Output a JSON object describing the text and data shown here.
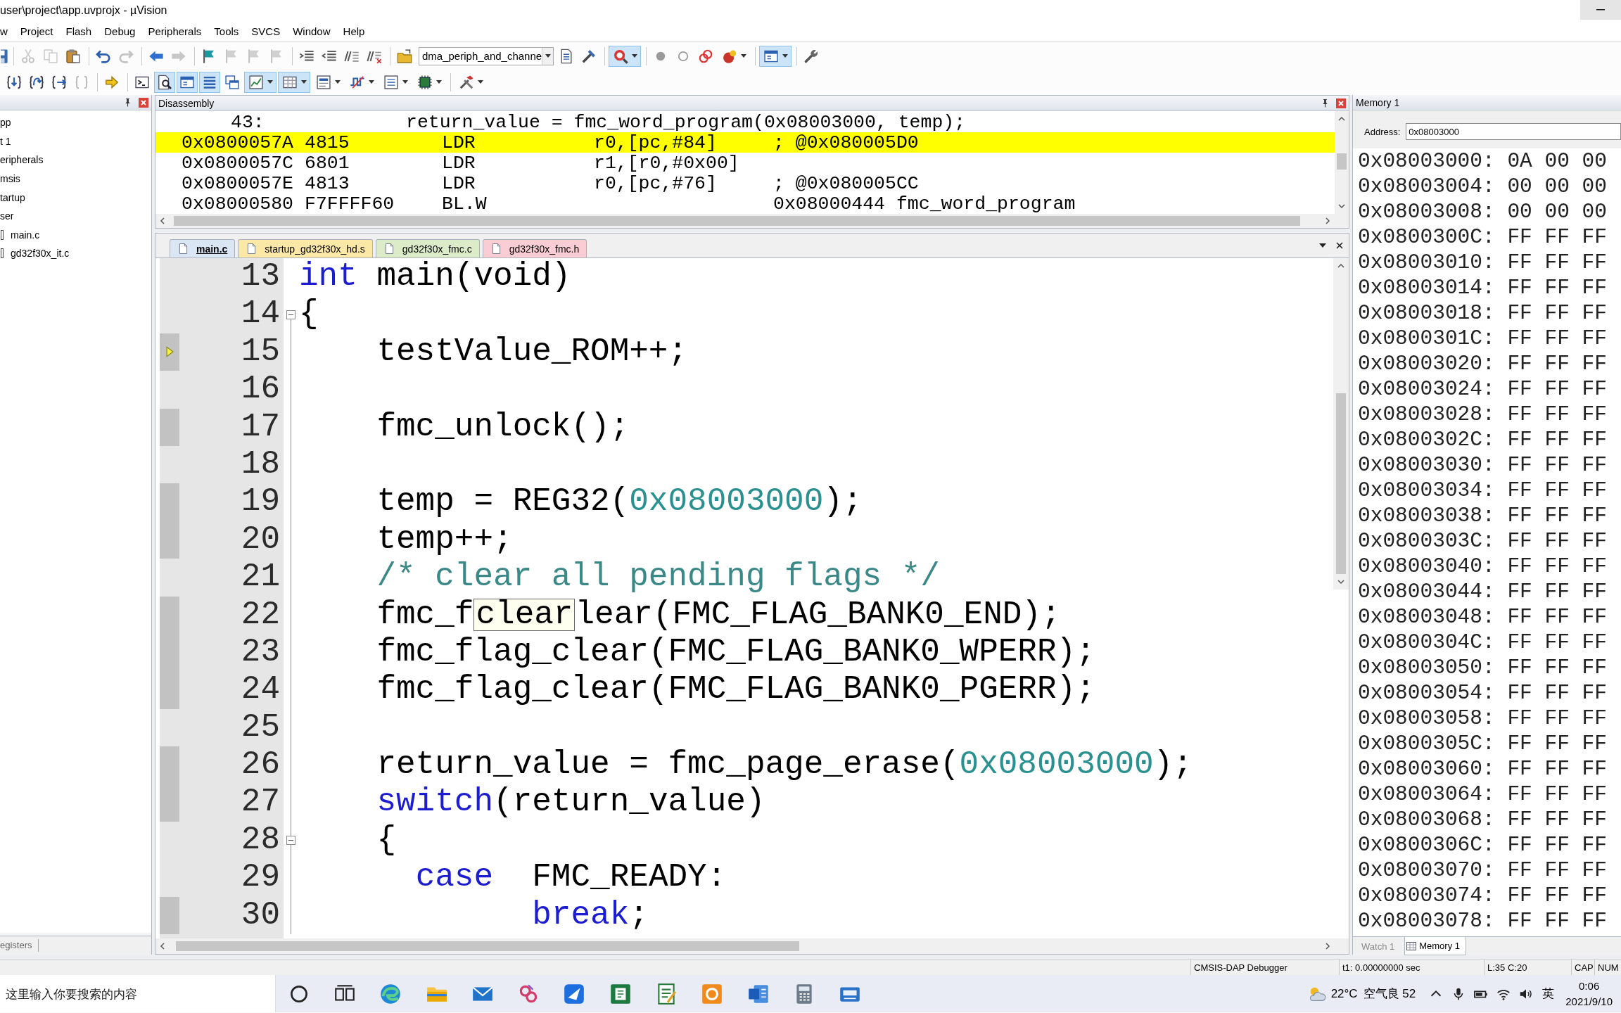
{
  "window": {
    "title": "user\\project\\app.uvprojx - µVision"
  },
  "menu": [
    "w",
    "Project",
    "Flash",
    "Debug",
    "Peripherals",
    "Tools",
    "SVCS",
    "Window",
    "Help"
  ],
  "toolbar_1": [
    [
      {
        "kind": "button",
        "disabled": false,
        "pressed": false,
        "dropdown": false
      }
    ],
    [
      {
        "kind": "button",
        "disabled": true,
        "pressed": false,
        "dropdown": false
      },
      {
        "kind": "button",
        "disabled": true,
        "pressed": false,
        "dropdown": false
      },
      {
        "kind": "button",
        "disabled": false,
        "pressed": false,
        "dropdown": false
      }
    ],
    [
      {
        "kind": "button",
        "disabled": false,
        "pressed": false,
        "dropdown": false
      },
      {
        "kind": "button",
        "disabled": true,
        "pressed": false,
        "dropdown": false
      }
    ],
    [
      {
        "kind": "button",
        "disabled": false,
        "pressed": false,
        "dropdown": false
      },
      {
        "kind": "button",
        "disabled": true,
        "pressed": false,
        "dropdown": false
      }
    ],
    [
      {
        "kind": "button",
        "disabled": false,
        "pressed": false,
        "dropdown": false
      },
      {
        "kind": "button",
        "disabled": true,
        "pressed": false,
        "dropdown": false
      },
      {
        "kind": "button",
        "disabled": true,
        "pressed": false,
        "dropdown": false
      },
      {
        "kind": "button",
        "disabled": true,
        "pressed": false,
        "dropdown": false
      }
    ],
    [
      {
        "kind": "button",
        "disabled": false,
        "pressed": false,
        "dropdown": false
      },
      {
        "kind": "button",
        "disabled": false,
        "pressed": false,
        "dropdown": false
      },
      {
        "kind": "button",
        "disabled": false,
        "pressed": false,
        "dropdown": false
      },
      {
        "kind": "button",
        "disabled": false,
        "pressed": false,
        "dropdown": false
      }
    ],
    [
      {
        "kind": "button",
        "disabled": false,
        "pressed": false,
        "dropdown": false
      },
      {
        "kind": "combo",
        "value": "dma_periph_and_channe"
      },
      {
        "kind": "button",
        "disabled": false,
        "pressed": false,
        "dropdown": false
      },
      {
        "kind": "button",
        "disabled": false,
        "pressed": false,
        "dropdown": false
      }
    ],
    [
      {
        "kind": "button",
        "disabled": false,
        "pressed": true,
        "dropdown": true
      }
    ],
    [
      {
        "kind": "button",
        "disabled": false,
        "pressed": false,
        "dropdown": false
      },
      {
        "kind": "button",
        "disabled": false,
        "pressed": false,
        "dropdown": false
      },
      {
        "kind": "button",
        "disabled": false,
        "pressed": false,
        "dropdown": false
      },
      {
        "kind": "button",
        "disabled": false,
        "pressed": false,
        "dropdown": true
      }
    ],
    [
      {
        "kind": "button",
        "disabled": false,
        "pressed": true,
        "dropdown": true
      }
    ],
    [
      {
        "kind": "button",
        "disabled": false,
        "pressed": false,
        "dropdown": false
      }
    ]
  ],
  "toolbar_2": [
    [
      {
        "kind": "button",
        "disabled": false,
        "pressed": false,
        "dropdown": false
      },
      {
        "kind": "button",
        "disabled": false,
        "pressed": false,
        "dropdown": false
      },
      {
        "kind": "button",
        "disabled": false,
        "pressed": false,
        "dropdown": false
      },
      {
        "kind": "button",
        "disabled": true,
        "pressed": false,
        "dropdown": false
      }
    ],
    [
      {
        "kind": "button",
        "disabled": false,
        "pressed": false,
        "dropdown": false
      }
    ],
    [
      {
        "kind": "button",
        "disabled": false,
        "pressed": false,
        "dropdown": false
      },
      {
        "kind": "button",
        "disabled": false,
        "pressed": true,
        "dropdown": false
      },
      {
        "kind": "button",
        "disabled": false,
        "pressed": true,
        "dropdown": false
      },
      {
        "kind": "button",
        "disabled": false,
        "pressed": true,
        "dropdown": false
      },
      {
        "kind": "button",
        "disabled": false,
        "pressed": false,
        "dropdown": false
      },
      {
        "kind": "button",
        "disabled": false,
        "pressed": true,
        "dropdown": true
      },
      {
        "kind": "button",
        "disabled": false,
        "pressed": true,
        "dropdown": true
      },
      {
        "kind": "button",
        "disabled": false,
        "pressed": false,
        "dropdown": true
      },
      {
        "kind": "button",
        "disabled": false,
        "pressed": false,
        "dropdown": true
      },
      {
        "kind": "button",
        "disabled": false,
        "pressed": false,
        "dropdown": true
      },
      {
        "kind": "button",
        "disabled": false,
        "pressed": false,
        "dropdown": true
      }
    ],
    [
      {
        "kind": "button",
        "disabled": false,
        "pressed": false,
        "dropdown": true
      }
    ]
  ],
  "project_panel": {
    "items": [
      {
        "label": "pp",
        "kind": "group",
        "children": [
          {
            "label": "t 1",
            "kind": "group",
            "children": [
              {
                "label": "eripherals",
                "kind": "group"
              },
              {
                "label": "msis",
                "kind": "group"
              },
              {
                "label": "tartup",
                "kind": "group"
              },
              {
                "label": "ser",
                "kind": "group",
                "children": [
                  {
                    "label": "main.c",
                    "kind": "file"
                  },
                  {
                    "label": "gd32f30x_it.c",
                    "kind": "file"
                  }
                ]
              }
            ]
          }
        ]
      }
    ],
    "tabs": [
      {
        "label": "egisters"
      }
    ]
  },
  "disassembly": {
    "title": "Disassembly",
    "lines": [
      {
        "kind": "source",
        "number": "43:",
        "text": "return_value = fmc_word_program(0x08003000, temp);",
        "selected": false
      },
      {
        "kind": "instruction",
        "address": "0x0800057A",
        "opcode": "4815",
        "mnemonic": "LDR",
        "operands": "r0,[pc,#84]",
        "comment": "; @0x080005D0",
        "selected": true
      },
      {
        "kind": "instruction",
        "address": "0x0800057C",
        "opcode": "6801",
        "mnemonic": "LDR",
        "operands": "r1,[r0,#0x00]",
        "selected": false
      },
      {
        "kind": "instruction",
        "address": "0x0800057E",
        "opcode": "4813",
        "mnemonic": "LDR",
        "operands": "r0,[pc,#76]",
        "comment": "; @0x080005CC",
        "selected": false
      },
      {
        "kind": "instruction",
        "address": "0x08000580",
        "opcode": "F7FFFF60",
        "mnemonic": "BL.W",
        "target": "0x08000444 fmc_word_program",
        "selected": false
      }
    ]
  },
  "editor": {
    "tabs": [
      {
        "label": "main.c",
        "selected": true,
        "color": "#dbe6f5"
      },
      {
        "label": "startup_gd32f30x_hd.s",
        "selected": false,
        "color": "#fbe8a6"
      },
      {
        "label": "gd32f30x_fmc.c",
        "selected": false,
        "color": "#dcecc9"
      },
      {
        "label": "gd32f30x_fmc.h",
        "selected": false,
        "color": "#f9cdd3"
      }
    ],
    "lines": [
      {
        "number": "13",
        "executable": false,
        "current": false,
        "fold": false,
        "segments": [
          {
            "kind": "keyword",
            "text": "int"
          },
          {
            "kind": "text",
            "text": " main(void)"
          }
        ]
      },
      {
        "number": "14",
        "executable": false,
        "current": false,
        "fold": true,
        "segments": [
          {
            "kind": "text",
            "text": "{"
          }
        ]
      },
      {
        "number": "15",
        "executable": true,
        "current": true,
        "fold": false,
        "segments": [
          {
            "kind": "text",
            "text": "    testValue_ROM++;"
          }
        ]
      },
      {
        "number": "16",
        "executable": false,
        "current": false,
        "fold": false
      },
      {
        "number": "17",
        "executable": true,
        "current": false,
        "fold": false,
        "segments": [
          {
            "kind": "text",
            "text": "    fmc_unlock();"
          }
        ]
      },
      {
        "number": "18",
        "executable": false,
        "current": false,
        "fold": false
      },
      {
        "number": "19",
        "executable": true,
        "current": false,
        "fold": false,
        "segments": [
          {
            "kind": "text",
            "text": "    temp = REG32("
          },
          {
            "kind": "number",
            "text": "0x08003000"
          },
          {
            "kind": "text",
            "text": ");"
          }
        ]
      },
      {
        "number": "20",
        "executable": true,
        "current": false,
        "fold": false,
        "segments": [
          {
            "kind": "text",
            "text": "    temp++;"
          }
        ]
      },
      {
        "number": "21",
        "executable": false,
        "current": false,
        "fold": false,
        "segments": [
          {
            "kind": "comment",
            "text": "    /* clear all pending flags */"
          }
        ]
      },
      {
        "number": "22",
        "executable": true,
        "current": false,
        "fold": false,
        "segments": [
          {
            "kind": "text",
            "text": "    fmc_f"
          },
          {
            "kind": "tooltip",
            "text": "clear"
          },
          {
            "kind": "text",
            "text": "lear(FMC_FLAG_BANK0_END);"
          }
        ]
      },
      {
        "number": "23",
        "executable": true,
        "current": false,
        "fold": false,
        "segments": [
          {
            "kind": "text",
            "text": "    fmc_flag_clear(FMC_FLAG_BANK0_WPERR);"
          }
        ]
      },
      {
        "number": "24",
        "executable": true,
        "current": false,
        "fold": false,
        "segments": [
          {
            "kind": "text",
            "text": "    fmc_flag_clear(FMC_FLAG_BANK0_PGERR);"
          }
        ]
      },
      {
        "number": "25",
        "executable": false,
        "current": false,
        "fold": false
      },
      {
        "number": "26",
        "executable": true,
        "current": false,
        "fold": false,
        "segments": [
          {
            "kind": "text",
            "text": "    return_value = fmc_page_erase("
          },
          {
            "kind": "number",
            "text": "0x08003000"
          },
          {
            "kind": "text",
            "text": ");"
          }
        ]
      },
      {
        "number": "27",
        "executable": true,
        "current": false,
        "fold": false,
        "segments": [
          {
            "kind": "keyword",
            "text": "    switch"
          },
          {
            "kind": "text",
            "text": "(return_value)"
          }
        ]
      },
      {
        "number": "28",
        "executable": false,
        "current": false,
        "fold": true,
        "segments": [
          {
            "kind": "text",
            "text": "    {"
          }
        ]
      },
      {
        "number": "29",
        "executable": false,
        "current": false,
        "fold": false,
        "segments": [
          {
            "kind": "keyword",
            "text": "      case"
          },
          {
            "kind": "text",
            "text": "  FMC_READY:"
          }
        ]
      },
      {
        "number": "30",
        "executable": true,
        "current": false,
        "fold": false,
        "segments": [
          {
            "kind": "keyword",
            "text": "            break"
          },
          {
            "kind": "text",
            "text": ";"
          }
        ]
      }
    ]
  },
  "memory": {
    "title": "Memory 1",
    "address_field": {
      "label": "Address:",
      "value": "0x08003000"
    },
    "rows": [
      {
        "address": "0x08003000:",
        "bytes": [
          "0A",
          "00",
          "00"
        ]
      },
      {
        "address": "0x08003004:",
        "bytes": [
          "00",
          "00",
          "00"
        ]
      },
      {
        "address": "0x08003008:",
        "bytes": [
          "00",
          "00",
          "00"
        ]
      },
      {
        "address": "0x0800300C:",
        "bytes": [
          "FF",
          "FF",
          "FF"
        ]
      },
      {
        "address": "0x08003010:",
        "bytes": [
          "FF",
          "FF",
          "FF"
        ]
      },
      {
        "address": "0x08003014:",
        "bytes": [
          "FF",
          "FF",
          "FF"
        ]
      },
      {
        "address": "0x08003018:",
        "bytes": [
          "FF",
          "FF",
          "FF"
        ]
      },
      {
        "address": "0x0800301C:",
        "bytes": [
          "FF",
          "FF",
          "FF"
        ]
      },
      {
        "address": "0x08003020:",
        "bytes": [
          "FF",
          "FF",
          "FF"
        ]
      },
      {
        "address": "0x08003024:",
        "bytes": [
          "FF",
          "FF",
          "FF"
        ]
      },
      {
        "address": "0x08003028:",
        "bytes": [
          "FF",
          "FF",
          "FF"
        ]
      },
      {
        "address": "0x0800302C:",
        "bytes": [
          "FF",
          "FF",
          "FF"
        ]
      },
      {
        "address": "0x08003030:",
        "bytes": [
          "FF",
          "FF",
          "FF"
        ]
      },
      {
        "address": "0x08003034:",
        "bytes": [
          "FF",
          "FF",
          "FF"
        ]
      },
      {
        "address": "0x08003038:",
        "bytes": [
          "FF",
          "FF",
          "FF"
        ]
      },
      {
        "address": "0x0800303C:",
        "bytes": [
          "FF",
          "FF",
          "FF"
        ]
      },
      {
        "address": "0x08003040:",
        "bytes": [
          "FF",
          "FF",
          "FF"
        ]
      },
      {
        "address": "0x08003044:",
        "bytes": [
          "FF",
          "FF",
          "FF"
        ]
      },
      {
        "address": "0x08003048:",
        "bytes": [
          "FF",
          "FF",
          "FF"
        ]
      },
      {
        "address": "0x0800304C:",
        "bytes": [
          "FF",
          "FF",
          "FF"
        ]
      },
      {
        "address": "0x08003050:",
        "bytes": [
          "FF",
          "FF",
          "FF"
        ]
      },
      {
        "address": "0x08003054:",
        "bytes": [
          "FF",
          "FF",
          "FF"
        ]
      },
      {
        "address": "0x08003058:",
        "bytes": [
          "FF",
          "FF",
          "FF"
        ]
      },
      {
        "address": "0x0800305C:",
        "bytes": [
          "FF",
          "FF",
          "FF"
        ]
      },
      {
        "address": "0x08003060:",
        "bytes": [
          "FF",
          "FF",
          "FF"
        ]
      },
      {
        "address": "0x08003064:",
        "bytes": [
          "FF",
          "FF",
          "FF"
        ]
      },
      {
        "address": "0x08003068:",
        "bytes": [
          "FF",
          "FF",
          "FF"
        ]
      },
      {
        "address": "0x0800306C:",
        "bytes": [
          "FF",
          "FF",
          "FF"
        ]
      },
      {
        "address": "0x08003070:",
        "bytes": [
          "FF",
          "FF",
          "FF"
        ]
      },
      {
        "address": "0x08003074:",
        "bytes": [
          "FF",
          "FF",
          "FF"
        ]
      },
      {
        "address": "0x08003078:",
        "bytes": [
          "FF",
          "FF",
          "FF"
        ]
      }
    ],
    "tabs": [
      {
        "label": "Watch 1",
        "selected": false
      },
      {
        "label": "Memory 1",
        "selected": true
      }
    ]
  },
  "status_bar": [
    "CMSIS-DAP Debugger",
    "t1: 0.00000000 sec",
    "L:35 C:20",
    "CAP",
    "NUM"
  ],
  "taskbar": {
    "search": {
      "placeholder": "这里输入你要搜索的内容"
    },
    "weather": {
      "temperature": "22°C",
      "air_quality": "空气良 52"
    },
    "input_method": "英",
    "clock": {
      "time": "0:06",
      "date": "2021/9/10"
    }
  }
}
